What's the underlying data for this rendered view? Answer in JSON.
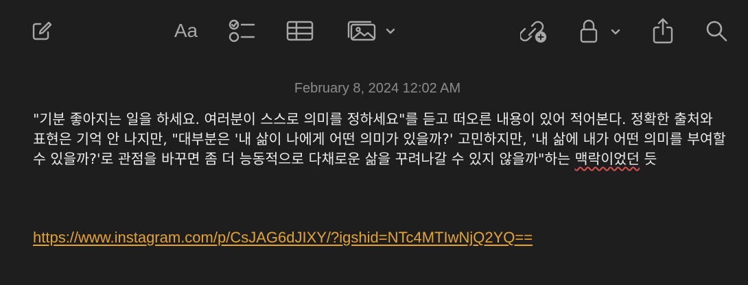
{
  "toolbar": {
    "icons": [
      "compose-icon",
      "format-icon",
      "checklist-icon",
      "table-icon",
      "media-icon",
      "collaborate-icon",
      "lock-icon",
      "share-icon",
      "search-icon"
    ],
    "format_label": "Aa",
    "icon_color": "#a8a8a8"
  },
  "note": {
    "timestamp": "February 8, 2024 12:02 AM",
    "body_main": "\"기분 좋아지는 일을 하세요. 여러분이 스스로 의미를 정하세요\"를 듣고 떠오른 내용이 있어 적어본다. 정확한 출처와 표현은 기억 안 나지만, \"대부분은 '내 삶이 나에게 어떤 의미가 있을까?' 고민하지만, '내 삶에 내가 어떤 의미를 부여할 수 있을까?'로 관점을 바꾸면 좀 더 능동적으로 다채로운 삶을 꾸려나갈 수 있지 않을까\"하는 ",
    "body_misspelled": "맥락이었던",
    "body_end": " 듯",
    "link": "https://www.instagram.com/p/CsJAG6dJIXY/?igshid=NTc4MTIwNjQ2YQ==",
    "colors": {
      "background": "#1e1e1e",
      "text": "#ececec",
      "timestamp": "#8c8c8c",
      "link": "#e5a431",
      "spellcheck": "#d9534f"
    }
  }
}
